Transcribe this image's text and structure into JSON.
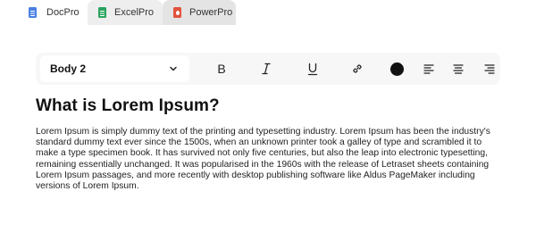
{
  "tabs": [
    {
      "label": "DocPro",
      "icon": "doc-file-icon",
      "color": "#4a7fe3",
      "active": true
    },
    {
      "label": "ExcelPro",
      "icon": "sheet-file-icon",
      "color": "#2aa35d",
      "active": false
    },
    {
      "label": "PowerPro",
      "icon": "slides-file-icon",
      "color": "#e2533c",
      "active": false
    }
  ],
  "toolbar": {
    "style_value": "Body 2",
    "bold_label": "B",
    "italic_icon": "italic-icon",
    "underline_icon": "underline-icon",
    "link_icon": "link-icon",
    "text_color": "#111111",
    "align_left_icon": "align-left-icon",
    "align_center_icon": "align-center-icon",
    "align_right_icon": "align-right-icon"
  },
  "document": {
    "heading": "What is Lorem Ipsum?",
    "paragraph": "Lorem Ipsum is simply dummy text of the printing and typesetting industry. Lorem Ipsum has been the industry's standard dummy text ever since the 1500s, when an unknown printer took a galley of type and scrambled it to make a type specimen book. It has survived not only five centuries, but also the leap into electronic typesetting, remaining essentially unchanged. It was popularised in the 1960s with the release of Letraset sheets containing Lorem Ipsum passages, and more recently with desktop publishing software like Aldus PageMaker including versions of Lorem Ipsum."
  }
}
